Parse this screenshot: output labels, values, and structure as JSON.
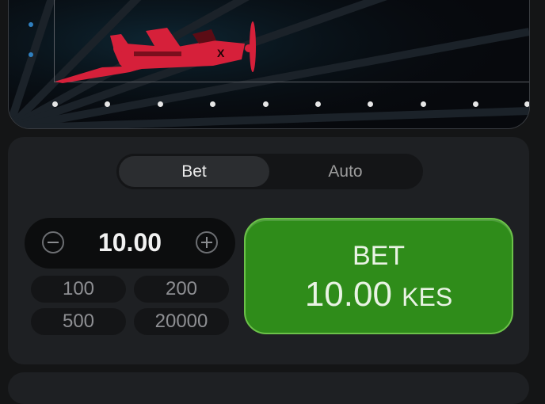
{
  "game": {
    "plane_mark": "X"
  },
  "bet_panel": {
    "tabs": [
      "Bet",
      "Auto"
    ],
    "active_tab": "Bet",
    "stepper_value": "10.00",
    "quick_amounts": [
      "100",
      "200",
      "500",
      "20000"
    ],
    "bet_button": {
      "title": "BET",
      "amount": "10.00",
      "currency": "KES"
    }
  },
  "colors": {
    "bet_green": "#2f8c1a",
    "plane_red": "#d6203a",
    "panel": "#1e2023"
  }
}
